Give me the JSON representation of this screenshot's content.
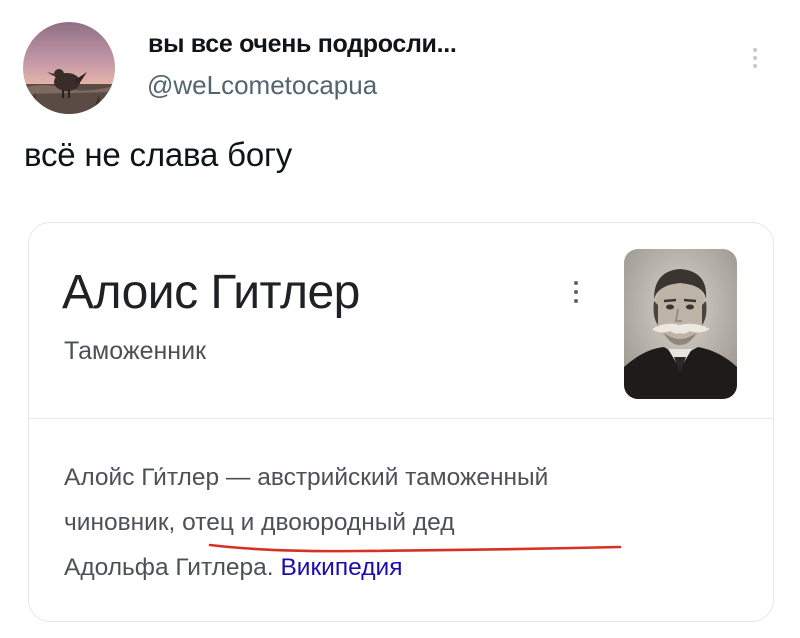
{
  "tweet": {
    "author": {
      "display_name": "вы все очень подросли...",
      "handle": "@weLcometocapua",
      "avatar_icon": "bird-on-beach-avatar"
    },
    "text": "всё не слава богу",
    "more_icon": "more-vertical-icon"
  },
  "knowledge_panel": {
    "title": "Алоис Гитлер",
    "subtitle": "Таможенник",
    "image_icon": "vintage-portrait-photo",
    "description_lines": [
      "Алойс Ги́тлер — австрийский таможенный",
      "чиновник, отец и двоюродный дед",
      "Адольфа Гитлера."
    ],
    "source_link": "Википедия",
    "link_color": "#1a0dab",
    "annotation_color": "#d93025"
  }
}
